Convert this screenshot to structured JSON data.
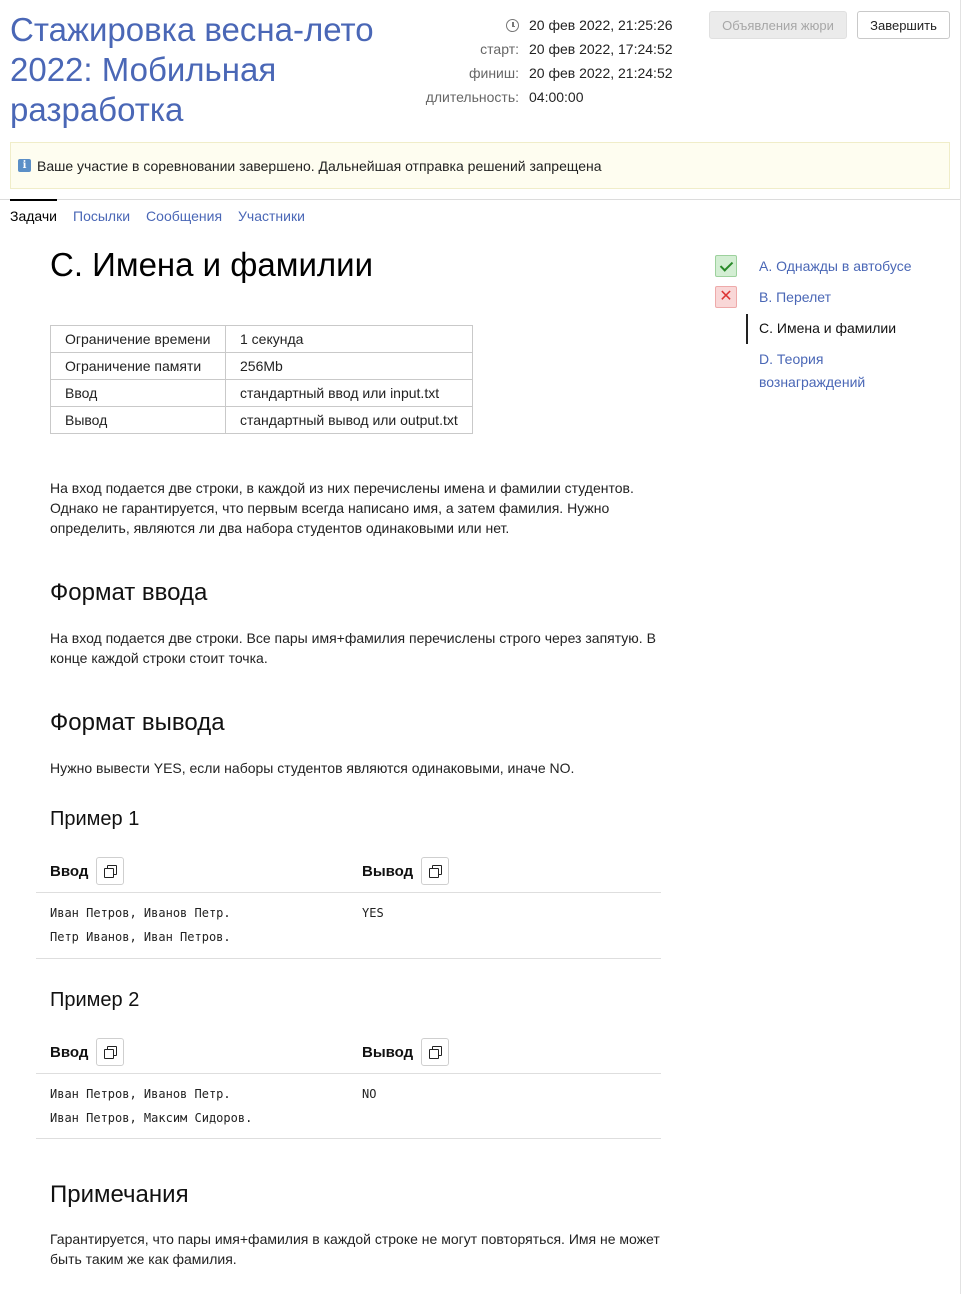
{
  "contest": {
    "title": "Стажировка весна-лето 2022: Мобильная разработка",
    "now": "20 фев 2022, 21:25:26",
    "start_label": "старт:",
    "start": "20 фев 2022, 17:24:52",
    "finish_label": "финиш:",
    "finish": "20 фев 2022, 21:24:52",
    "duration_label": "длительность:",
    "duration": "04:00:00"
  },
  "buttons": {
    "jury": "Объявления жюри",
    "finish": "Завершить"
  },
  "notice": "Ваше участие в соревновании завершено. Дальнейшая отправка решений запрещена",
  "tabs": [
    {
      "label": "Задачи",
      "active": true
    },
    {
      "label": "Посылки"
    },
    {
      "label": "Сообщения"
    },
    {
      "label": "Участники"
    }
  ],
  "problem": {
    "title": "C. Имена и фамилии",
    "limits": [
      {
        "key": "Ограничение времени",
        "value": "1 секунда"
      },
      {
        "key": "Ограничение памяти",
        "value": "256Mb"
      },
      {
        "key": "Ввод",
        "value": "стандартный ввод или input.txt"
      },
      {
        "key": "Вывод",
        "value": "стандартный вывод или output.txt"
      }
    ],
    "statement": "На вход подается две строки, в каждой из них перечислены имена и фамилии студентов. Однако не гарантируется, что первым всегда написано имя, а затем фамилия. Нужно определить, являются ли два набора студентов одинаковыми или нет.",
    "input_heading": "Формат ввода",
    "input_text": "На вход подается две строки. Все пары имя+фамилия перечислены строго через запятую. В конце каждой строки стоит точка.",
    "output_heading": "Формат вывода",
    "output_text": "Нужно вывести YES, если наборы студентов являются одинаковыми, иначе NO.",
    "samples": [
      {
        "title": "Пример 1",
        "input_label": "Ввод",
        "output_label": "Вывод",
        "input": "Иван Петров, Иванов Петр.\nПетр Иванов, Иван Петров.",
        "output": "YES"
      },
      {
        "title": "Пример 2",
        "input_label": "Ввод",
        "output_label": "Вывод",
        "input": "Иван Петров, Иванов Петр.\nИван Петров, Максим Сидоров.",
        "output": "NO"
      }
    ],
    "notes_heading": "Примечания",
    "notes_text": "Гарантируется, что пары имя+фамилия в каждой строке не могут повторяться. Имя не может быть таким же как фамилия."
  },
  "sidebar": {
    "problems": [
      {
        "label": "A. Однажды в автобусе",
        "status": "ok"
      },
      {
        "label": "B. Перелет",
        "status": "fail",
        "status_icon": "✕"
      },
      {
        "label": "C. Имена и фамилии",
        "status": "none",
        "current": true
      },
      {
        "label": "D. Теория вознаграждений",
        "status": "none"
      }
    ]
  }
}
